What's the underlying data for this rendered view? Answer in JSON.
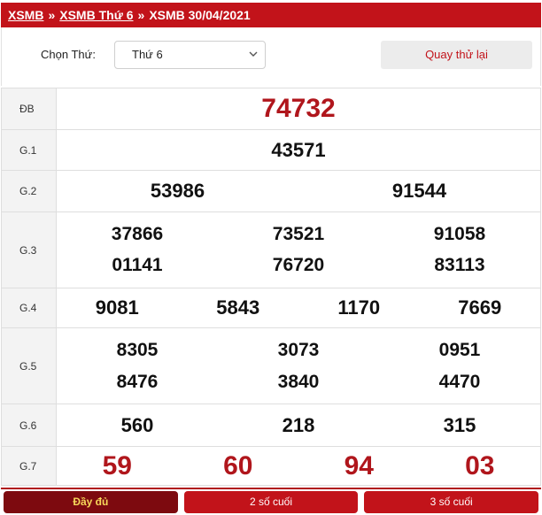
{
  "breadcrumb": {
    "items": [
      "XSMB",
      "XSMB Thứ 6",
      "XSMB 30/04/2021"
    ],
    "separator": "»"
  },
  "filter": {
    "label": "Chọn Thứ:",
    "selected_day": "Thứ 6",
    "retry_button": "Quay thử lại"
  },
  "results": {
    "db": {
      "label": "ĐB",
      "numbers": [
        "74732"
      ]
    },
    "g1": {
      "label": "G.1",
      "numbers": [
        "43571"
      ]
    },
    "g2": {
      "label": "G.2",
      "numbers": [
        "53986",
        "91544"
      ]
    },
    "g3": {
      "label": "G.3",
      "numbers": [
        "37866",
        "73521",
        "91058",
        "01141",
        "76720",
        "83113"
      ]
    },
    "g4": {
      "label": "G.4",
      "numbers": [
        "9081",
        "5843",
        "1170",
        "7669"
      ]
    },
    "g5": {
      "label": "G.5",
      "numbers": [
        "8305",
        "3073",
        "0951",
        "8476",
        "3840",
        "4470"
      ]
    },
    "g6": {
      "label": "G.6",
      "numbers": [
        "560",
        "218",
        "315"
      ]
    },
    "g7": {
      "label": "G.7",
      "numbers": [
        "59",
        "60",
        "94",
        "03"
      ]
    }
  },
  "tabs": [
    {
      "label": "Đầy đủ",
      "active": true
    },
    {
      "label": "2 số cuối",
      "active": false
    },
    {
      "label": "3 số cuối",
      "active": false
    }
  ],
  "colors": {
    "brand_red": "#c2131a",
    "prize_red": "#b0161c",
    "active_tab_bg": "#7d0a0f",
    "active_tab_text": "#f7d75a"
  }
}
